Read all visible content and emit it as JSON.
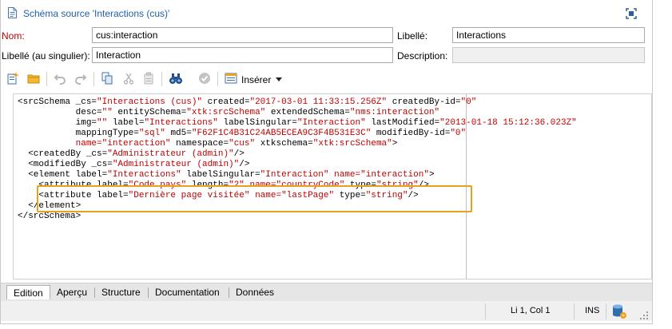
{
  "window": {
    "title": "Schéma source  'Interactions (cus)'",
    "icons": {
      "document": "document-icon",
      "maximize": "maximize-icon"
    }
  },
  "form": {
    "name_label": "Nom:",
    "name_value": "cus:interaction",
    "label_label": "Libellé:",
    "label_value": "Interactions",
    "singular_label": "Libellé (au singulier):",
    "singular_value": "Interaction",
    "description_label": "Description:",
    "description_value": ""
  },
  "toolbar": {
    "icons": [
      "new-icon",
      "open-folder-icon",
      "undo-icon",
      "redo-icon",
      "copy-icon",
      "cut-icon",
      "paste-icon",
      "find-binoculars-icon",
      "check-icon",
      "insert-icon"
    ],
    "insert_label": "Insérer"
  },
  "code": {
    "lines": [
      [
        [
          "a",
          "<srcSchema _cs="
        ],
        [
          "v",
          "\"Interactions (cus)\""
        ],
        [
          "a",
          " created="
        ],
        [
          "v",
          "\"2017-03-01 11:33:15.256Z\""
        ],
        [
          "a",
          " createdBy-id="
        ],
        [
          "v",
          "\"0\""
        ]
      ],
      [
        [
          "a",
          "           desc="
        ],
        [
          "v",
          "\"\""
        ],
        [
          "a",
          " entitySchema="
        ],
        [
          "v",
          "\"xtk:srcSchema\""
        ],
        [
          "a",
          " extendedSchema="
        ],
        [
          "v",
          "\"nms:interaction\""
        ]
      ],
      [
        [
          "a",
          "           img="
        ],
        [
          "v",
          "\"\""
        ],
        [
          "a",
          " label="
        ],
        [
          "v",
          "\"Interactions\""
        ],
        [
          "a",
          " labelSingular="
        ],
        [
          "v",
          "\"Interaction\""
        ],
        [
          "a",
          " lastModified="
        ],
        [
          "v",
          "\"2013-01-18 15:12:36.023Z\""
        ]
      ],
      [
        [
          "a",
          "           mappingType="
        ],
        [
          "v",
          "\"sql\""
        ],
        [
          "a",
          " md5="
        ],
        [
          "v",
          "\"F62F1C4B31C24AB5ECEA9C3F4B531E3C\""
        ],
        [
          "a",
          " modifiedBy-id="
        ],
        [
          "v",
          "\"0\""
        ]
      ],
      [
        [
          "a",
          "           "
        ],
        [
          "v",
          "name="
        ],
        [
          "a",
          ""
        ],
        [
          "v",
          "\"interaction\""
        ],
        [
          "a",
          " namespace="
        ],
        [
          "v",
          "\"cus\""
        ],
        [
          "a",
          " xtkschema="
        ],
        [
          "v",
          "\"xtk:srcSchema\""
        ],
        [
          "a",
          ">"
        ]
      ],
      [
        [
          "a",
          "  <createdBy _cs="
        ],
        [
          "v",
          "\"Administrateur (admin)\""
        ],
        [
          "a",
          "/>"
        ]
      ],
      [
        [
          "a",
          "  <modifiedBy _cs="
        ],
        [
          "v",
          "\"Administrateur (admin)\""
        ],
        [
          "a",
          "/>"
        ]
      ],
      [
        [
          "a",
          "  <element label="
        ],
        [
          "v",
          "\"Interactions\""
        ],
        [
          "a",
          " labelSingular="
        ],
        [
          "v",
          "\"Interaction\""
        ],
        [
          "a",
          " "
        ],
        [
          "v",
          "name="
        ],
        [
          "v",
          "\"interaction\""
        ],
        [
          "a",
          ">"
        ]
      ],
      [
        [
          "a",
          "    <attribute label="
        ],
        [
          "v",
          "\"Code pays\""
        ],
        [
          "a",
          " length="
        ],
        [
          "v",
          "\"2\""
        ],
        [
          "a",
          " "
        ],
        [
          "v",
          "name="
        ],
        [
          "v",
          "\"countryCode\""
        ],
        [
          "a",
          " type="
        ],
        [
          "v",
          "\"string\""
        ],
        [
          "a",
          "/>"
        ]
      ],
      [
        [
          "a",
          "    <attribute label="
        ],
        [
          "v",
          "\"Dernière page visitée\""
        ],
        [
          "a",
          " "
        ],
        [
          "v",
          "name="
        ],
        [
          "v",
          "\"lastPage\""
        ],
        [
          "a",
          " type="
        ],
        [
          "v",
          "\"string\""
        ],
        [
          "a",
          "/>"
        ]
      ],
      [
        [
          "a",
          "  </element>"
        ]
      ],
      [
        [
          "a",
          "</srcSchema>"
        ]
      ]
    ]
  },
  "tabs": [
    "Edition",
    "Aperçu",
    "Structure",
    "Documentation",
    "Données"
  ],
  "active_tab": "Edition",
  "status": {
    "position": "Li 1, Col 1",
    "mode": "INS",
    "icons": [
      "database-icon",
      "resize-grip-icon"
    ]
  },
  "colors": {
    "title": "#1f5fa8",
    "required_label": "#c00000",
    "attr_value": "#c00000",
    "highlight": "#e8a020"
  }
}
